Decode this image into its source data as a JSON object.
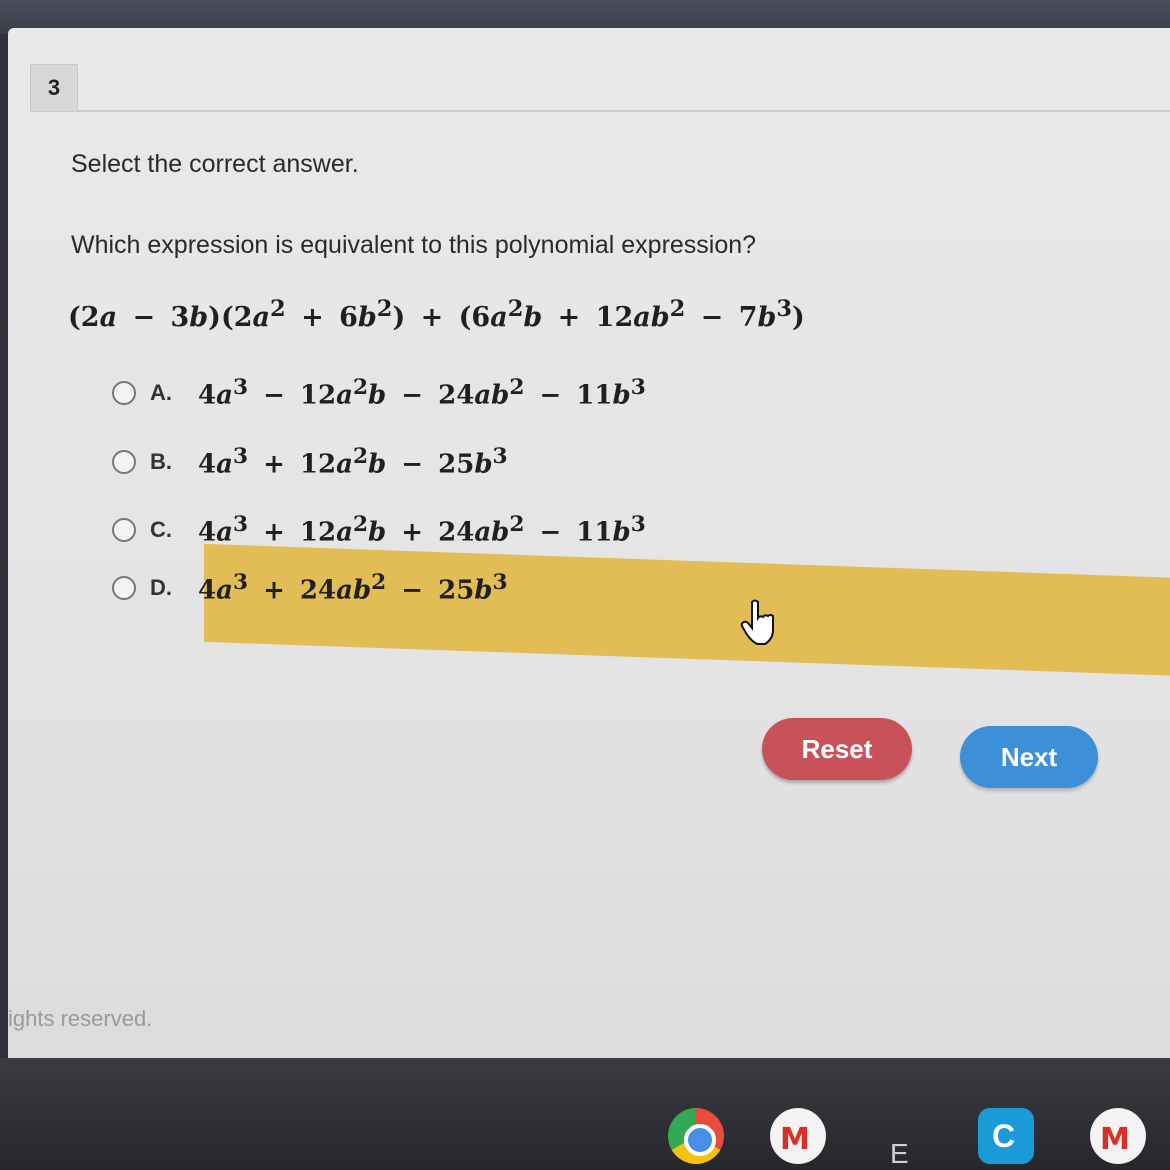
{
  "question": {
    "number": "3",
    "instruction": "Select the correct answer.",
    "prompt": "Which expression is equivalent to this polynomial expression?",
    "expression_html": "(2<i>a</i> − 3<i>b</i>)(2<i>a</i><sup>2</sup> + 6<i>b</i><sup>2</sup>) + (6<i>a</i><sup>2</sup><i>b</i> + 12<i>ab</i><sup>2</sup> − 7<i>b</i><sup>3</sup>)"
  },
  "options": [
    {
      "letter": "A.",
      "expr_html": "4<i>a</i><sup>3</sup> − 12<i>a</i><sup>2</sup><i>b</i> − 24<i>ab</i><sup>2</sup> − 11<i>b</i><sup>3</sup>",
      "selected": false
    },
    {
      "letter": "B.",
      "expr_html": "4<i>a</i><sup>3</sup> + 12<i>a</i><sup>2</sup><i>b</i> − 25<i>b</i><sup>3</sup>",
      "selected": false
    },
    {
      "letter": "C.",
      "expr_html": "4<i>a</i><sup>3</sup> + 12<i>a</i><sup>2</sup><i>b</i> + 24<i>ab</i><sup>2</sup> − 11<i>b</i><sup>3</sup>",
      "selected": false
    },
    {
      "letter": "D.",
      "expr_html": "4<i>a</i><sup>3</sup> + 24<i>ab</i><sup>2</sup> − 25<i>b</i><sup>3</sup>",
      "selected": false,
      "hovered": true
    }
  ],
  "buttons": {
    "reset": "Reset",
    "next": "Next"
  },
  "footer": "ights reserved.",
  "taskbar": {
    "apps": [
      "chrome-icon",
      "gmail-icon",
      "E",
      "classroom-icon",
      "gmail-icon"
    ],
    "e_label": "E"
  },
  "colors": {
    "highlight": "#e2bd55",
    "reset": "#c8525a",
    "next": "#3d8fd8"
  }
}
